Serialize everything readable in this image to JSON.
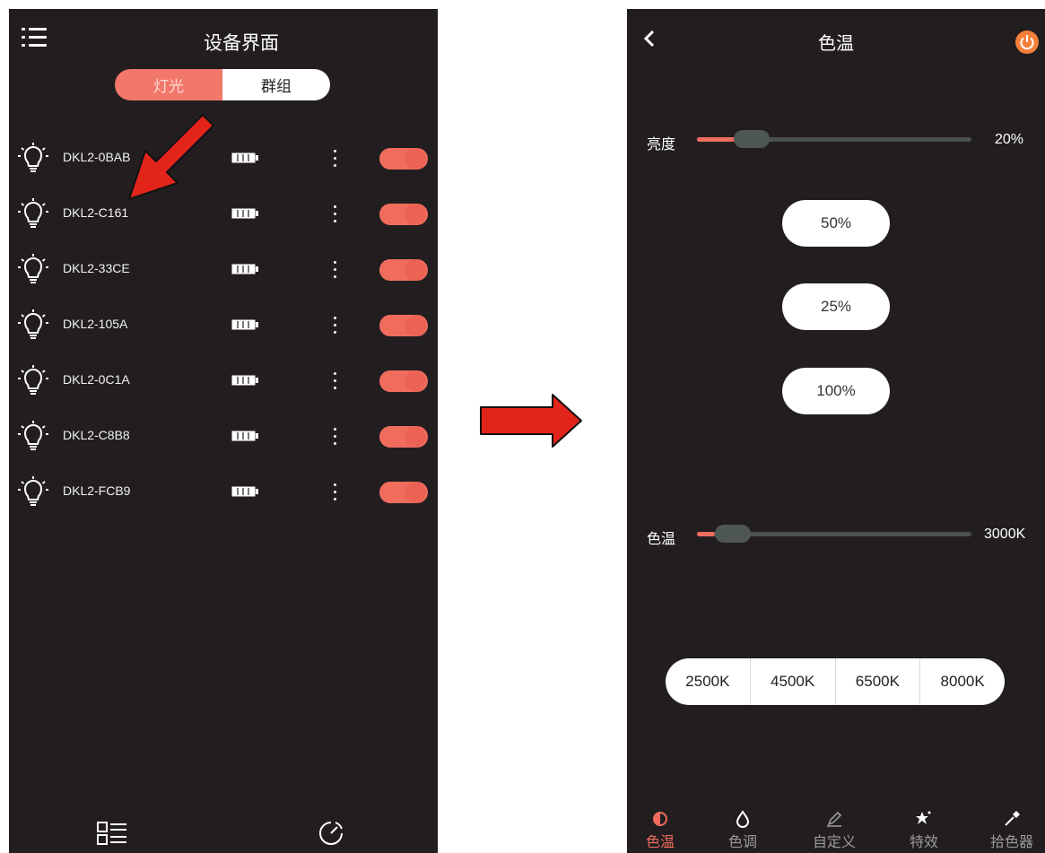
{
  "left": {
    "title": "设备界面",
    "tabs": {
      "lights": "灯光",
      "groups": "群组"
    },
    "devices": [
      {
        "name": "DKL2-0BAB",
        "on": true
      },
      {
        "name": "DKL2-C161",
        "on": true
      },
      {
        "name": "DKL2-33CE",
        "on": true
      },
      {
        "name": "DKL2-105A",
        "on": true
      },
      {
        "name": "DKL2-0C1A",
        "on": true
      },
      {
        "name": "DKL2-C8B8",
        "on": true
      },
      {
        "name": "DKL2-FCB9",
        "on": true
      }
    ],
    "icons": [
      "menu-icon",
      "bulb-icon",
      "battery-icon",
      "more-icon",
      "list-view-icon",
      "timer-icon"
    ]
  },
  "right": {
    "title": "色温",
    "brightness": {
      "label": "亮度",
      "value": "20%",
      "level": 0.2
    },
    "presets": [
      "50%",
      "25%",
      "100%"
    ],
    "color_temp": {
      "label": "色温",
      "value": "3000K",
      "level": 0.06
    },
    "ct_presets": [
      "2500K",
      "4500K",
      "6500K",
      "8000K"
    ],
    "bottom_tabs": [
      {
        "label": "色温",
        "icon": "contrast-icon",
        "active": true
      },
      {
        "label": "色调",
        "icon": "drop-icon",
        "active": false
      },
      {
        "label": "自定义",
        "icon": "pen-icon",
        "active": false
      },
      {
        "label": "特效",
        "icon": "sparkle-icon",
        "active": false
      },
      {
        "label": "拾色器",
        "icon": "eyedropper-icon",
        "active": false
      }
    ]
  },
  "colors": {
    "accent": "#f06d5e",
    "background": "#221e1f",
    "power": "#f4813a",
    "annotation_arrow": "#e3241b"
  }
}
